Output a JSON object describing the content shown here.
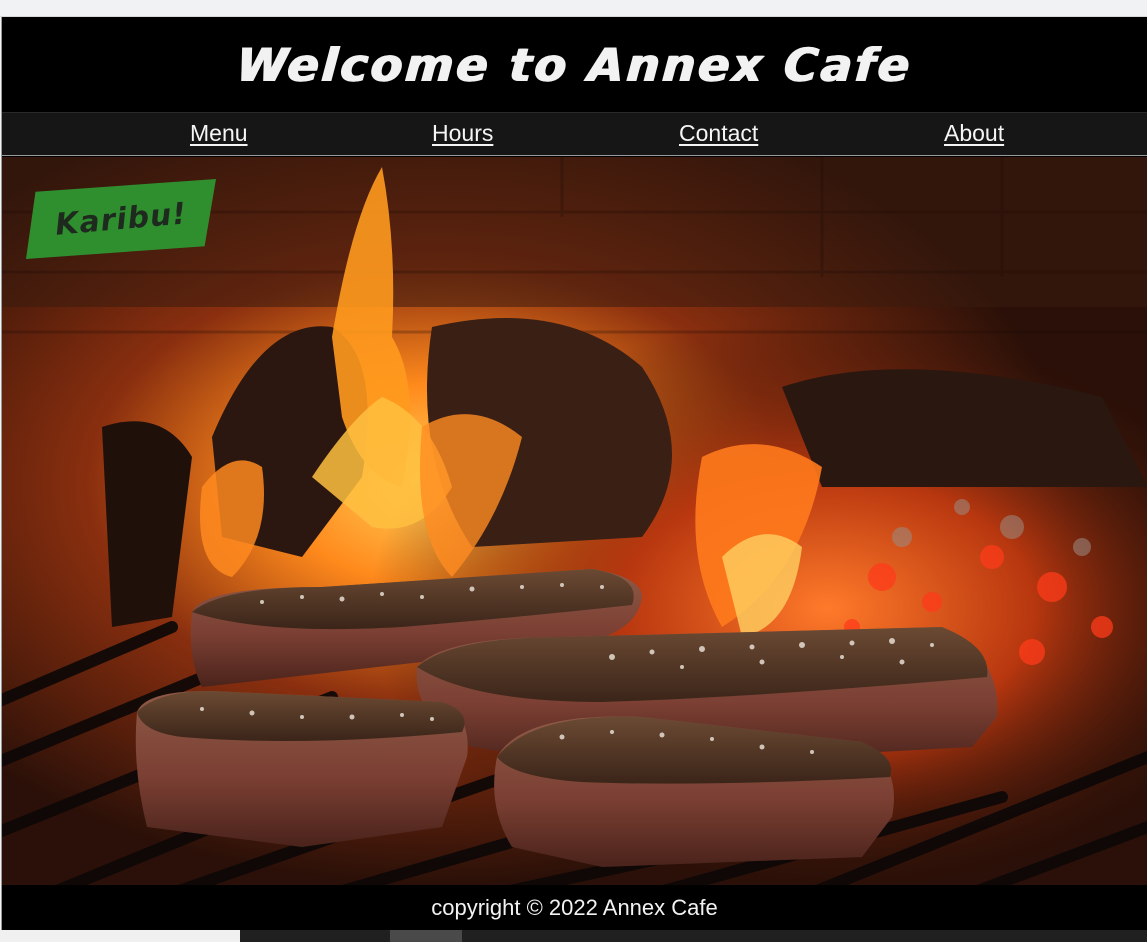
{
  "header": {
    "title": "Welcome to Annex Cafe"
  },
  "nav": {
    "items": [
      {
        "label": "Menu"
      },
      {
        "label": "Hours"
      },
      {
        "label": "Contact"
      },
      {
        "label": "About"
      }
    ]
  },
  "hero": {
    "badge": "Karibu!",
    "image_icon": "grilled-steaks-fire-photo"
  },
  "footer": {
    "copyright": "copyright © 2022 Annex Cafe"
  },
  "colors": {
    "header_bg": "#000000",
    "nav_bg": "#161616",
    "text": "#f2f2f2",
    "badge_bg": "#2f8f2f"
  }
}
